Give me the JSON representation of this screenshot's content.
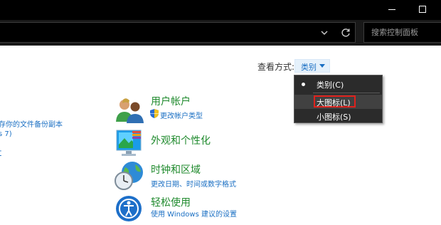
{
  "window": {
    "minimize_icon": "minimize-icon",
    "maximize_icon": "maximize-icon"
  },
  "address_bar": {
    "dropdown_icon": "chevron-down-icon",
    "refresh_icon": "refresh-icon",
    "search_placeholder": "搜索控制面板"
  },
  "left_links": {
    "link1": "存你的文件备份副本",
    "link2": "s 7)",
    "link3": "t"
  },
  "view_by": {
    "label": "查看方式:",
    "selected": "类别",
    "arrow": "▼"
  },
  "view_menu": {
    "items": [
      {
        "label": "类别(C)",
        "selected": true
      },
      {
        "label": "大图标(L)",
        "hovered": true,
        "highlight_color": "#e0211c"
      },
      {
        "label": "小图标(S)"
      }
    ]
  },
  "categories": [
    {
      "title": "用户帐户",
      "sub": "更改帐户类型",
      "icon": "users-icon",
      "sub_icon": "shield-icon"
    },
    {
      "title": "外观和个性化",
      "icon": "appearance-icon"
    },
    {
      "title": "时钟和区域",
      "sub": "更改日期、时间或数字格式",
      "icon": "clock-globe-icon"
    },
    {
      "title": "轻松使用",
      "sub": "使用 Windows 建议的设置",
      "icon": "ease-of-access-icon"
    }
  ],
  "colors": {
    "category_title": "#1f8a2d",
    "link": "#1a6fc3",
    "titlebar": "#000000",
    "menu_bg": "#2b2b2b"
  }
}
